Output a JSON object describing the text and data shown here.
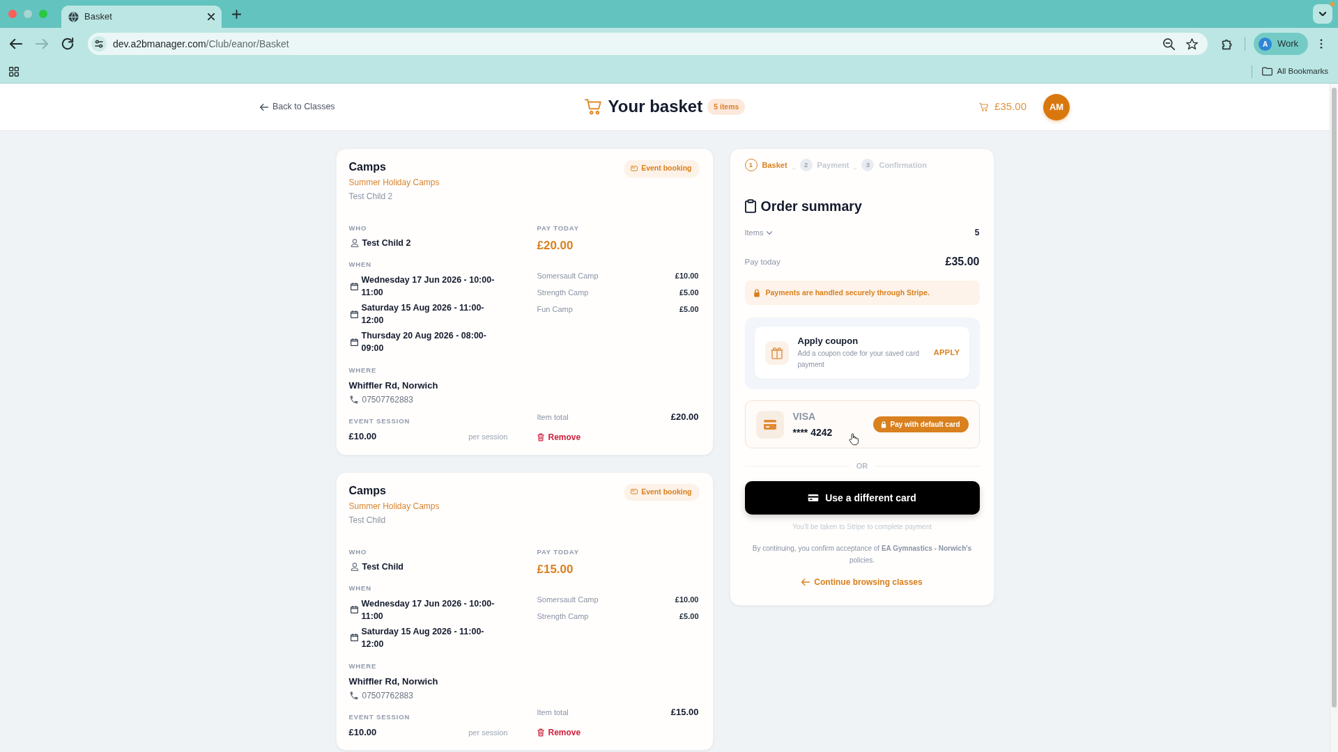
{
  "browser": {
    "window_controls": [
      {
        "kind": "close",
        "disabled": false
      },
      {
        "kind": "minimize",
        "disabled": true
      },
      {
        "kind": "maximize",
        "disabled": false
      }
    ],
    "tabs": [
      {
        "title": "Basket",
        "selected": true
      }
    ],
    "nav_buttons": [
      {
        "kind": "back",
        "disabled": false
      },
      {
        "kind": "forward",
        "disabled": true
      },
      {
        "kind": "reload",
        "disabled": false
      }
    ],
    "address": {
      "host": "dev.a2bmanager.com",
      "path": "/Club/eanor/Basket"
    },
    "profile": {
      "initial": "A",
      "label": "Work"
    },
    "bookmarks_folder": "All Bookmarks"
  },
  "header": {
    "back_link": "Back to Classes",
    "title": "Your basket",
    "count_badge": "5 items",
    "cart_total": "£35.00",
    "avatar": "AM"
  },
  "basket_items": [
    {
      "category": "Camps",
      "event": "Summer Holiday Camps",
      "participant": "Test Child 2",
      "badge": "Event booking",
      "who_label": "WHO",
      "who": "Test Child 2",
      "when_label": "WHEN",
      "dates": [
        "Wednesday 17 Jun 2026 - 10:00-11:00",
        "Saturday 15 Aug 2026 - 11:00-12:00",
        "Thursday 20 Aug 2026 - 08:00-09:00"
      ],
      "where_label": "WHERE",
      "venue": "Whiffler Rd, Norwich",
      "phone": "07507762883",
      "session_label": "EVENT SESSION",
      "session_price": "£10.00",
      "session_unit": "per session",
      "pay_today_label": "PAY TODAY",
      "pay_today": "£20.00",
      "lines": [
        {
          "name": "Somersault Camp",
          "price": "£10.00"
        },
        {
          "name": "Strength Camp",
          "price": "£5.00"
        },
        {
          "name": "Fun Camp",
          "price": "£5.00"
        }
      ],
      "total_label": "Item total",
      "total": "£20.00",
      "remove": "Remove"
    },
    {
      "category": "Camps",
      "event": "Summer Holiday Camps",
      "participant": "Test Child",
      "badge": "Event booking",
      "who_label": "WHO",
      "who": "Test Child",
      "when_label": "WHEN",
      "dates": [
        "Wednesday 17 Jun 2026 - 10:00-11:00",
        "Saturday 15 Aug 2026 - 11:00-12:00"
      ],
      "where_label": "WHERE",
      "venue": "Whiffler Rd, Norwich",
      "phone": "07507762883",
      "session_label": "EVENT SESSION",
      "session_price": "£10.00",
      "session_unit": "per session",
      "pay_today_label": "PAY TODAY",
      "pay_today": "£15.00",
      "lines": [
        {
          "name": "Somersault Camp",
          "price": "£10.00"
        },
        {
          "name": "Strength Camp",
          "price": "£5.00"
        }
      ],
      "total_label": "Item total",
      "total": "£15.00",
      "remove": "Remove"
    }
  ],
  "summary": {
    "steps": [
      {
        "number": "1",
        "label": "Basket",
        "selected": true
      },
      {
        "number": "2",
        "label": "Payment",
        "selected": false
      },
      {
        "number": "3",
        "label": "Confirmation",
        "selected": false
      }
    ],
    "title": "Order summary",
    "items": {
      "label": "Items",
      "value": "5",
      "expanded": false
    },
    "pay_today": {
      "label": "Pay today",
      "value": "£35.00"
    },
    "security_note": "Payments are handled securely through Stripe.",
    "coupon": {
      "title": "Apply coupon",
      "description": "Add a coupon code for your saved card payment",
      "action": "APPLY"
    },
    "saved_card": {
      "brand": "VISA",
      "number": "**** 4242",
      "button": "Pay with default card"
    },
    "divider": "OR",
    "alt_button": "Use a different card",
    "alt_note": "You'll be taken to Stripe to complete payment",
    "terms": "By continuing, you confirm acceptance of **EA Gymnastics - Norwich's** policies.",
    "continue_link": "Continue browsing classes"
  }
}
